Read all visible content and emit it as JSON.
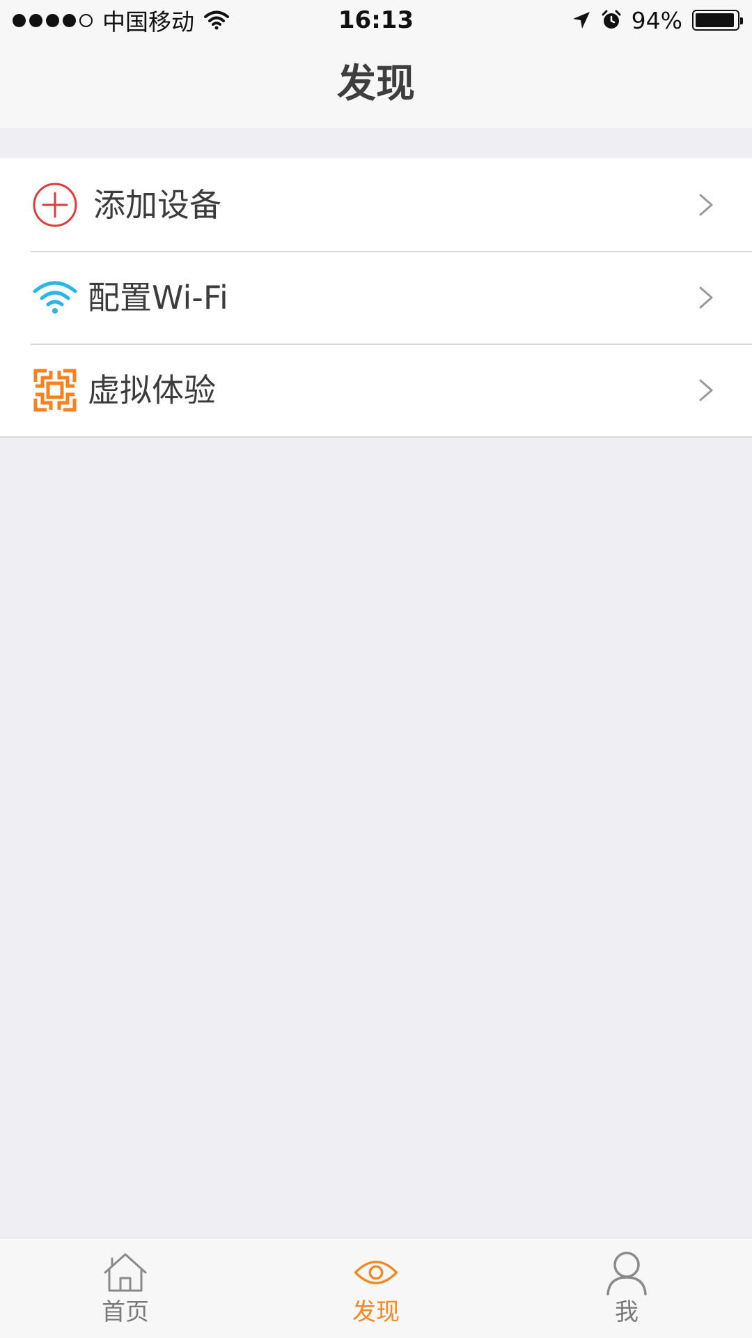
{
  "status_bar": {
    "carrier": "中国移动",
    "time": "16:13",
    "battery_percent": "94%",
    "battery_level": 0.94,
    "signal_bars_filled": 4,
    "signal_bars_total": 5,
    "icons": [
      "signal-dots-icon",
      "wifi-icon",
      "location-arrow-icon",
      "alarm-icon",
      "battery-icon"
    ]
  },
  "nav": {
    "title": "发现"
  },
  "list": {
    "items": [
      {
        "label": "添加设备",
        "icon": "add-circle-icon",
        "icon_color": "#e03b3b"
      },
      {
        "label": "配置Wi-Fi",
        "icon": "wifi-icon",
        "icon_color": "#29b6e8"
      },
      {
        "label": "虚拟体验",
        "icon": "scan-frame-icon",
        "icon_color": "#f5821f"
      }
    ]
  },
  "tab_bar": {
    "active_color": "#f08a24",
    "inactive_color": "#7a7a7a",
    "tabs": [
      {
        "label": "首页",
        "icon": "home-icon",
        "active": false
      },
      {
        "label": "发现",
        "icon": "eye-icon",
        "active": true
      },
      {
        "label": "我",
        "icon": "person-icon",
        "active": false
      }
    ]
  }
}
